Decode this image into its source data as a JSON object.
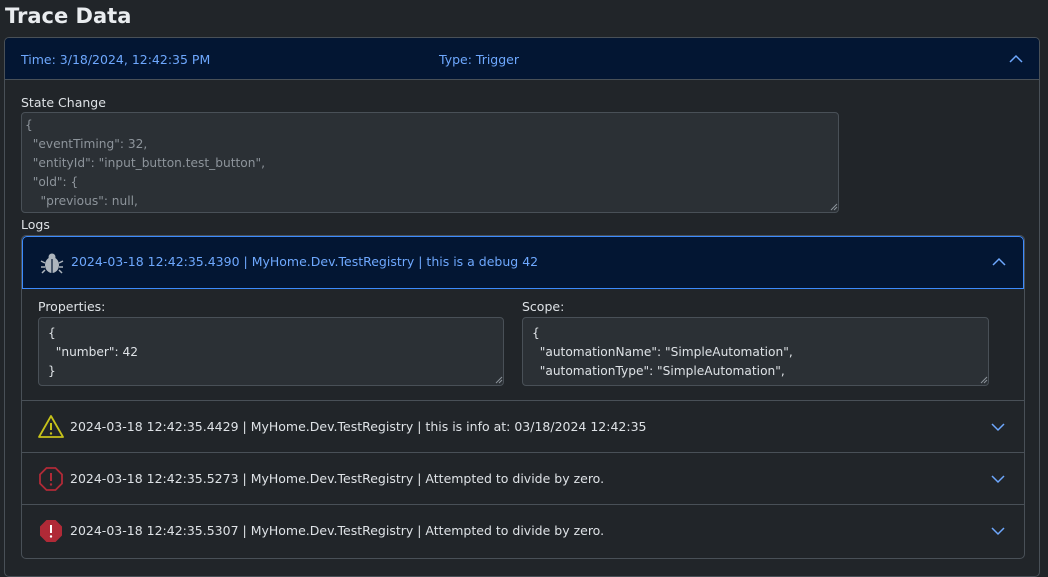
{
  "page": {
    "title": "Trace Data"
  },
  "trace": {
    "time": "Time: 3/18/2024, 12:42:35 PM",
    "type": "Type: Trigger",
    "state_change_label": "State Change",
    "state_change_value": "{\n  \"eventTiming\": 32,\n  \"entityId\": \"input_button.test_button\",\n  \"old\": {\n    \"previous\": null,",
    "logs_label": "Logs"
  },
  "logs": [
    {
      "level": "debug",
      "icon": "bug-icon",
      "text": "2024-03-18 12:42:35.4390 | MyHome.Dev.TestRegistry | this is a debug 42",
      "expanded": true,
      "properties_label": "Properties:",
      "properties_value": "{\n  \"number\": 42\n}",
      "scope_label": "Scope:",
      "scope_value": "{\n  \"automationName\": \"SimpleAutomation\",\n  \"automationType\": \"SimpleAutomation\","
    },
    {
      "level": "warning",
      "icon": "warning-triangle-icon",
      "text": "2024-03-18 12:42:35.4429 | MyHome.Dev.TestRegistry | this is info at: 03/18/2024 12:42:35",
      "expanded": false
    },
    {
      "level": "error",
      "icon": "error-octagon-outline-icon",
      "text": "2024-03-18 12:42:35.5273 | MyHome.Dev.TestRegistry | Attempted to divide by zero.",
      "expanded": false
    },
    {
      "level": "critical",
      "icon": "error-octagon-filled-icon",
      "text": "2024-03-18 12:42:35.5307 | MyHome.Dev.TestRegistry | Attempted to divide by zero.",
      "expanded": false
    }
  ],
  "colors": {
    "background": "#212529",
    "header_active": "#031633",
    "link_blue": "#6ea8fe",
    "warning": "#c6c21a",
    "error": "#b02a37"
  }
}
